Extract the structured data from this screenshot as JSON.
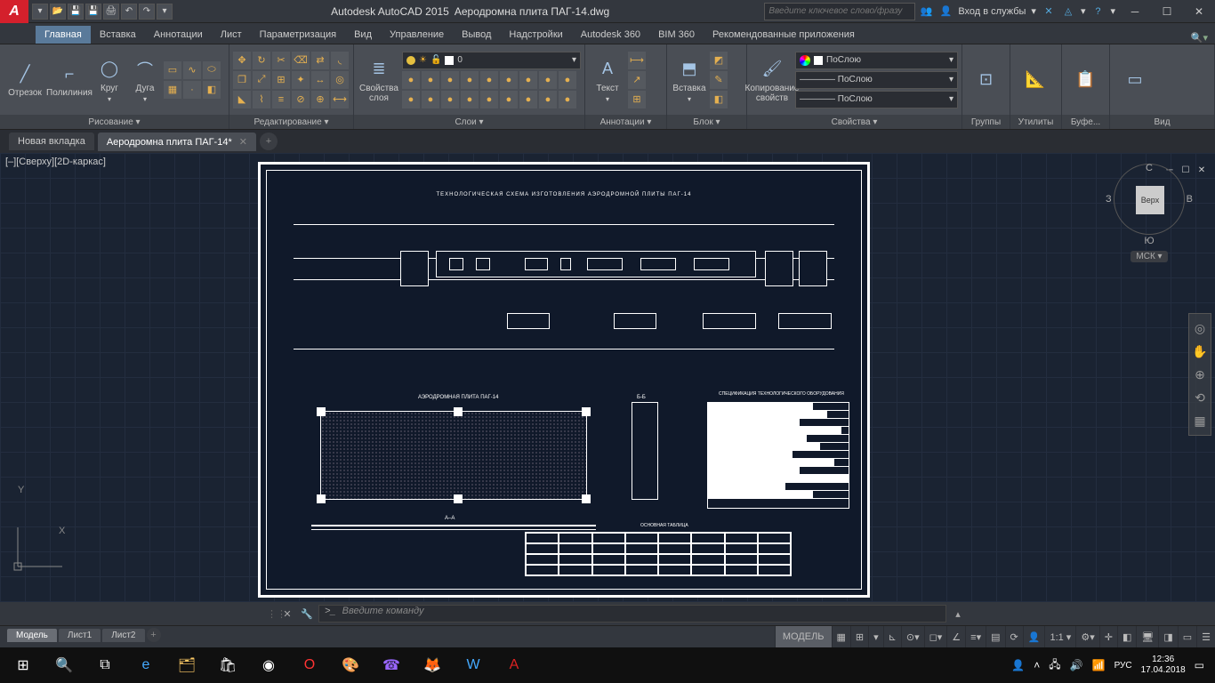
{
  "appName": "Autodesk AutoCAD 2015",
  "docTitle": "Аеродромна плита ПАГ-14.dwg",
  "searchPlaceholder": "Введите ключевое слово/фразу",
  "signIn": "Вход в службы",
  "ribbonTabs": [
    "Главная",
    "Вставка",
    "Аннотации",
    "Лист",
    "Параметризация",
    "Вид",
    "Управление",
    "Вывод",
    "Надстройки",
    "Autodesk 360",
    "BIM 360",
    "Рекомендованные приложения"
  ],
  "panels": {
    "draw": "Рисование ▾",
    "modify": "Редактирование ▾",
    "layers": "Слои ▾",
    "annotation": "Аннотации ▾",
    "block": "Блок ▾",
    "properties": "Свойства ▾",
    "groups": "Группы",
    "utilities": "Утилиты",
    "clipboard": "Буфе...",
    "view": "Вид"
  },
  "drawBtns": {
    "line": "Отрезок",
    "polyline": "Полилиния",
    "circle": "Круг",
    "arc": "Дуга"
  },
  "layerProp": "Свойства\nслоя",
  "layerCurrent": "0",
  "annBtn": "Текст",
  "blockBtn": "Вставка",
  "copyProps": "Копирование\nсвойств",
  "byLayer": "ПоСлою",
  "byLayer2": "———— ПоСлою",
  "byLayer3": "———— ПоСлою",
  "fileTabs": {
    "new": "Новая вкладка",
    "doc": "Аеродромна плита ПАГ-14*"
  },
  "vsLabel": "[–][Сверху][2D-каркас]",
  "viewcube": {
    "top": "Верх",
    "n": "С",
    "s": "Ю",
    "e": "В",
    "w": "З",
    "wcs": "МСК ▾"
  },
  "commandPlaceholder": "Введите команду",
  "layoutTabs": {
    "model": "Модель",
    "l1": "Лист1",
    "l2": "Лист2"
  },
  "statusModel": "МОДЕЛЬ",
  "scale": "1:1 ▾",
  "lang": "РУС",
  "clock": {
    "time": "12:36",
    "date": "17.04.2018"
  },
  "ucs": {
    "x": "X",
    "y": "Y"
  }
}
